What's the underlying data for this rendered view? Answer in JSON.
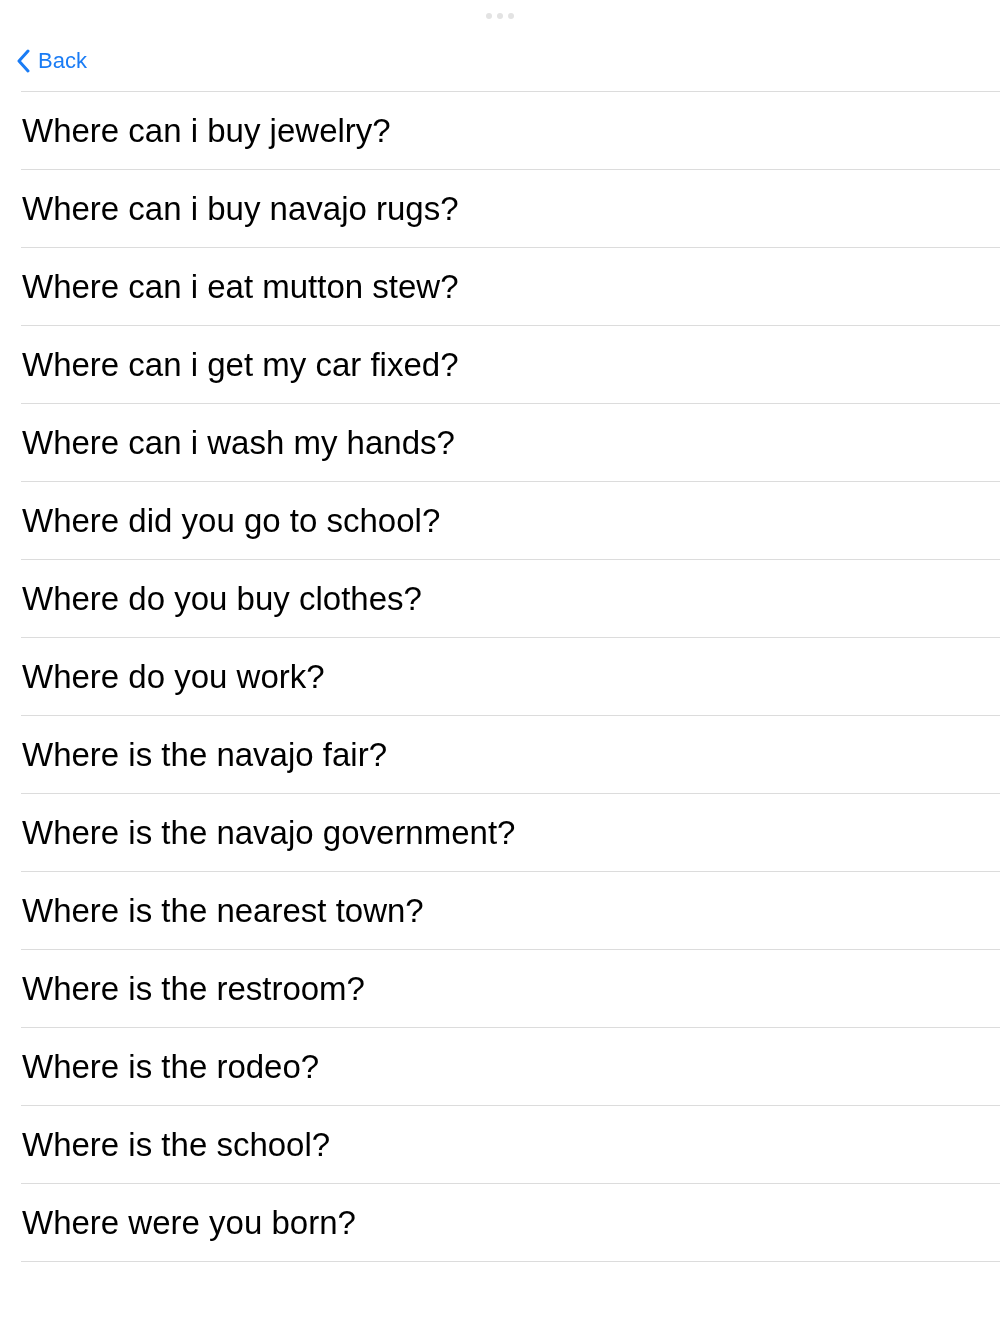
{
  "nav": {
    "back": "Back"
  },
  "questions": [
    "Where can i buy jewelry?",
    "Where can i buy navajo rugs?",
    "Where can i eat mutton stew?",
    "Where can i get my car fixed?",
    "Where can i wash my hands?",
    "Where did you go to school?",
    "Where do you buy clothes?",
    "Where do you work?",
    "Where is the navajo fair?",
    "Where is the navajo government?",
    "Where is the nearest town?",
    "Where is the restroom?",
    "Where is the rodeo?",
    "Where is the school?",
    "Where were you born?"
  ]
}
